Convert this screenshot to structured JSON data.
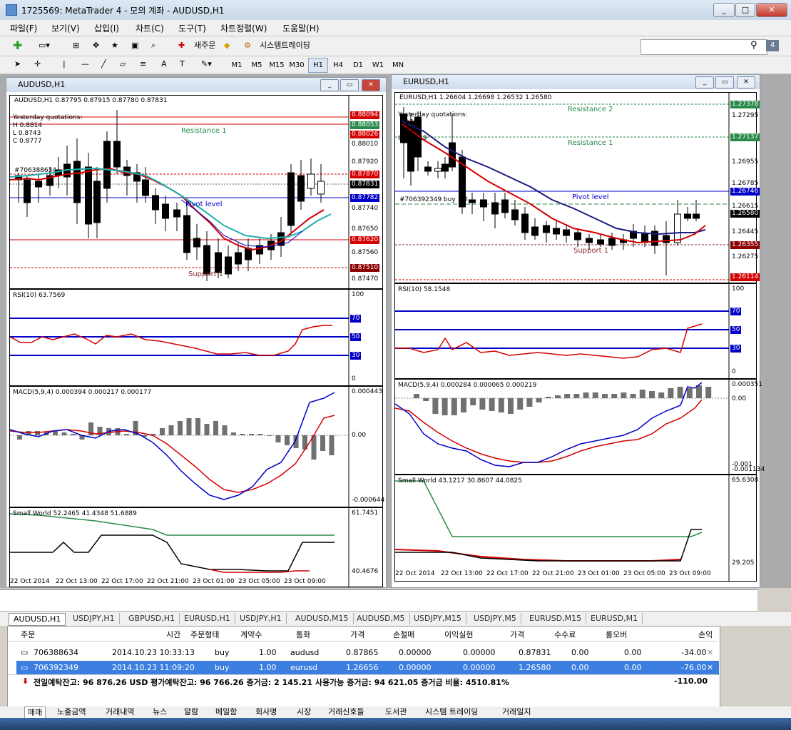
{
  "window": {
    "title": "1725569: MetaTrader 4 - 모의 계좌 - AUDUSD,H1"
  },
  "menu": [
    "파일(F)",
    "보기(V)",
    "삽입(I)",
    "차트(C)",
    "도구(T)",
    "차트정렬(W)",
    "도움말(H)"
  ],
  "toolbar": {
    "new_order": "새주문",
    "auto_trading": "시스템트레이딩",
    "timeframes": [
      "M1",
      "M5",
      "M15",
      "M30",
      "H1",
      "H4",
      "D1",
      "W1",
      "MN"
    ],
    "active_timeframe": "H1"
  },
  "charts": [
    {
      "window_title": "AUDUSD,H1",
      "header": "AUDUSD,H1  0.87795 0.87915 0.87780 0.87831",
      "quotes": [
        "Yesterday quotations:",
        "H 0.8814",
        "L 0.8743",
        "C 0.8777"
      ],
      "order_label": "#706388634",
      "lines": {
        "resistance": "Resistance 1",
        "pivot": "Pivot level",
        "support": "Support 1"
      },
      "price_axis": [
        "0.88094",
        "0.88053",
        "0.88026",
        "0.88010",
        "0.87920",
        "0.87870",
        "0.87831",
        "0.87782",
        "0.87740",
        "0.87650",
        "0.87620",
        "0.87560",
        "0.87510",
        "0.87470"
      ],
      "rsi": {
        "label": "RSI(10) 63.7569",
        "levels": [
          "100",
          "70",
          "50",
          "30",
          "0"
        ]
      },
      "macd": {
        "label": "MACD(5,9,4) 0.000394 0.000217 0.000177",
        "axis": [
          "0.000443",
          "0.00",
          "-0.000644"
        ]
      },
      "sw": {
        "label": "Small World 52.2465 41.4348 51.6889",
        "axis": [
          "61.7451",
          "40.4676"
        ]
      },
      "time_axis": [
        "22 Oct 2014",
        "22 Oct 13:00",
        "22 Oct 17:00",
        "22 Oct 21:00",
        "23 Oct 01:00",
        "23 Oct 05:00",
        "23 Oct 09:00"
      ]
    },
    {
      "window_title": "EURUSD,H1",
      "header": "EURUSD,H1  1.26604 1.26698 1.26532 1.26580",
      "quotes": [
        "Yesterday quotations:",
        "2739",
        "336",
        "C 1.2649"
      ],
      "order_label": "#706392349 buy 1.0",
      "lines": {
        "resistance2": "Resistance 2",
        "resistance": "Resistance 1",
        "pivot": "Pivot level",
        "support": "Support 1"
      },
      "price_axis": [
        "1.27378",
        "1.27295",
        "1.27137",
        "1.26955",
        "1.26785",
        "1.26746",
        "1.26615",
        "1.26580",
        "1.26445",
        "1.26355",
        "1.26275",
        "1.26114"
      ],
      "rsi": {
        "label": "RSI(10) 58.1548",
        "levels": [
          "100",
          "70",
          "50",
          "30",
          "0"
        ]
      },
      "macd": {
        "label": "MACD(5,9,4) 0.000284 0.000065 0.000219",
        "axis": [
          "0.000351",
          "0.00",
          "-0.001",
          "-0.001134"
        ]
      },
      "sw": {
        "label": "Small World 43.1217 30.8607 44.0825",
        "axis": [
          "65.6308",
          "29.205"
        ]
      },
      "time_axis": [
        "22 Oct 2014",
        "22 Oct 13:00",
        "22 Oct 17:00",
        "22 Oct 21:00",
        "23 Oct 01:00",
        "23 Oct 05:00",
        "23 Oct 09:00"
      ]
    }
  ],
  "symbol_tabs": [
    "AUDUSD,H1",
    "USDJPY,H1",
    "GBPUSD,H1",
    "EURUSD,H1",
    "USDJPY,H1",
    "AUDUSD,M15",
    "AUDUSD,M5",
    "USDJPY,M15",
    "USDJPY,M5",
    "EURUSD,M15",
    "EURUSD,M1"
  ],
  "terminal": {
    "headers": [
      "주문",
      "시간",
      "주문형태",
      "계약수",
      "통화",
      "가격",
      "손절매",
      "이익실현",
      "가격",
      "수수료",
      "롤오버",
      "손익"
    ],
    "rows": [
      {
        "order": "706388634",
        "time": "2014.10.23 10:33:13",
        "type": "buy",
        "size": "1.00",
        "symbol": "audusd",
        "price": "0.87865",
        "sl": "0.00000",
        "tp": "0.00000",
        "cur": "0.87831",
        "commission": "0.00",
        "swap": "0.00",
        "profit": "-34.00"
      },
      {
        "order": "706392349",
        "time": "2014.10.23 11:09:20",
        "type": "buy",
        "size": "1.00",
        "symbol": "eurusd",
        "price": "1.26656",
        "sl": "0.00000",
        "tp": "0.00000",
        "cur": "1.26580",
        "commission": "0.00",
        "swap": "0.00",
        "profit": "-76.00"
      }
    ],
    "summary": "전일예탁잔고: 96 876.26 USD  평가예탁잔고: 96 766.26  증거금: 2 145.21  사용가능 증거금: 94 621.05  증거금 비율: 4510.81%",
    "total": "-110.00"
  },
  "bottom_tabs": [
    "매매",
    "노출금액",
    "거래내역",
    "뉴스",
    "알람",
    "메일함",
    "회사명",
    "시장",
    "거래신호들",
    "도서관",
    "시스템 트레이딩",
    "거래일지"
  ],
  "colors": {
    "bull": "#ffffff",
    "bear": "#000000",
    "red": "#d40000",
    "blue": "#0000c8",
    "teal": "#20b0b0",
    "green": "#2a8a4a"
  }
}
